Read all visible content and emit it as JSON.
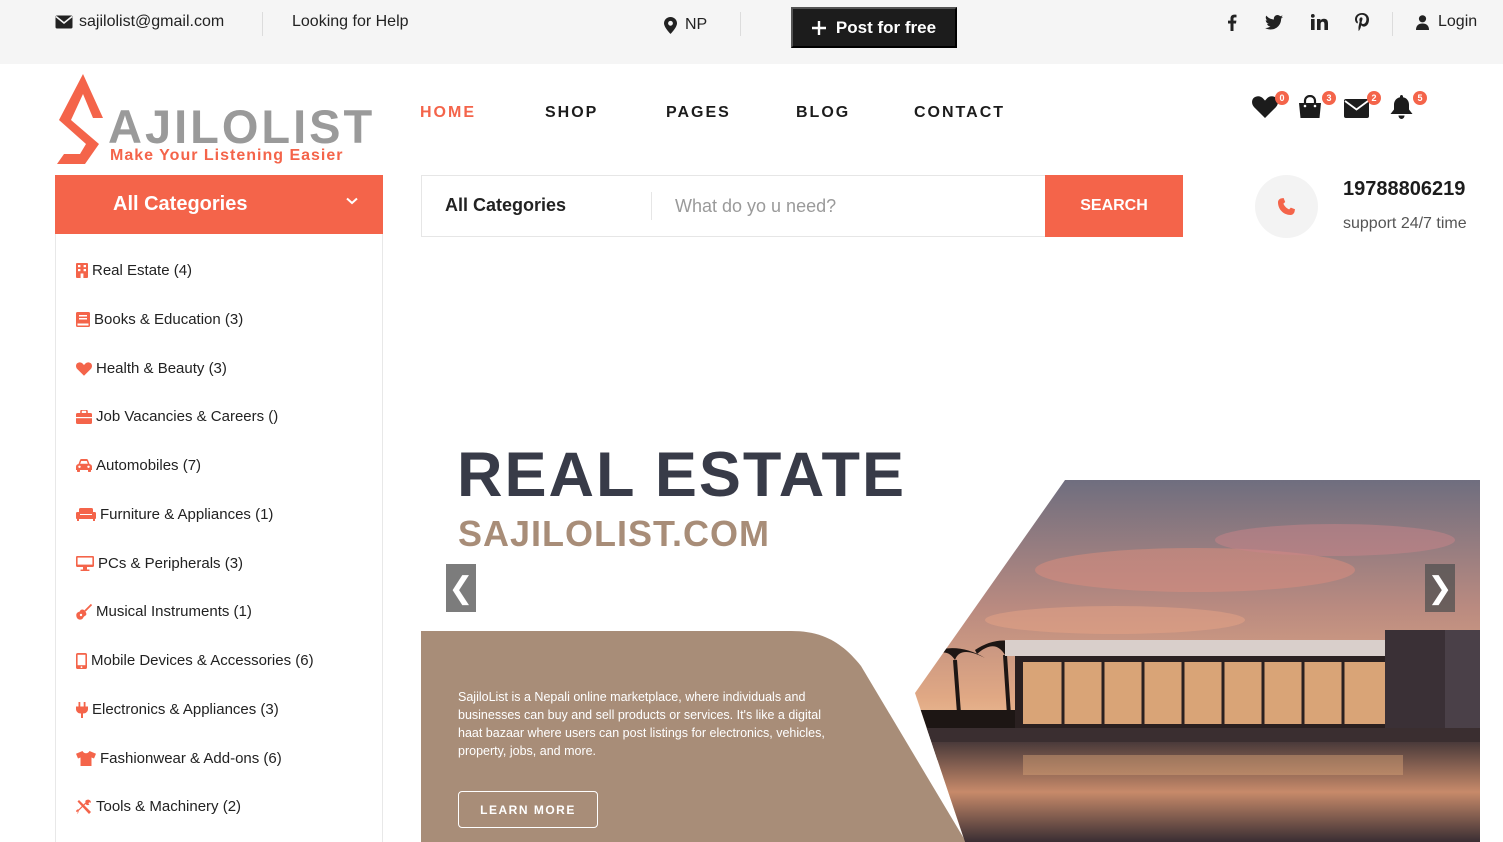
{
  "topbar": {
    "email": "sajilolist@gmail.com",
    "help": "Looking for Help",
    "location": "NP",
    "post_label": "Post for free",
    "social": [
      "facebook-icon",
      "twitter-icon",
      "linkedin-icon",
      "pinterest-icon"
    ],
    "login": "Login"
  },
  "logo": {
    "wordmark": "AJILOLIST",
    "tagline": "Make Your Listening Easier"
  },
  "nav": [
    {
      "label": "HOME",
      "active": true
    },
    {
      "label": "SHOP",
      "active": false
    },
    {
      "label": "PAGES",
      "active": false
    },
    {
      "label": "BLOG",
      "active": false
    },
    {
      "label": "CONTACT",
      "active": false
    }
  ],
  "header_icons": [
    {
      "icon": "heart-icon",
      "count": "0"
    },
    {
      "icon": "shopping-bag-icon",
      "count": "3"
    },
    {
      "icon": "envelope-icon",
      "count": "2"
    },
    {
      "icon": "bell-icon",
      "count": "5"
    }
  ],
  "categories": {
    "title": "All Categories",
    "items": [
      {
        "label": "Real Estate (4)",
        "icon": "building-icon"
      },
      {
        "label": "Books & Education (3)",
        "icon": "book-icon"
      },
      {
        "label": "Health & Beauty (3)",
        "icon": "heart-icon"
      },
      {
        "label": "Job Vacancies & Careers ()",
        "icon": "briefcase-icon"
      },
      {
        "label": "Automobiles (7)",
        "icon": "car-icon"
      },
      {
        "label": "Furniture & Appliances (1)",
        "icon": "couch-icon"
      },
      {
        "label": "PCs & Peripherals (3)",
        "icon": "desktop-icon"
      },
      {
        "label": "Musical Instruments (1)",
        "icon": "guitar-icon"
      },
      {
        "label": "Mobile Devices & Accessories (6)",
        "icon": "mobile-icon"
      },
      {
        "label": "Electronics & Appliances (3)",
        "icon": "plug-icon"
      },
      {
        "label": "Fashionwear & Add-ons (6)",
        "icon": "tshirt-icon"
      },
      {
        "label": "Tools & Machinery (2)",
        "icon": "tools-icon"
      }
    ]
  },
  "search": {
    "category": "All Categories",
    "placeholder": "What do yo u need?",
    "button": "SEARCH"
  },
  "support": {
    "phone": "19788806219",
    "text": "support 24/7 time"
  },
  "hero": {
    "title": "REAL ESTATE",
    "subtitle": "SAJILOLIST.COM",
    "description": "SajiloList is a Nepali online marketplace, where individuals and businesses can buy and sell products or services. It's like a digital haat bazaar where users can post listings for electronics, vehicles, property, jobs, and more.",
    "button": "LEARN MORE",
    "prev": "❮",
    "next": "❯"
  },
  "colors": {
    "accent": "#f4644a",
    "dark": "#1c1c1c",
    "hero_title": "#383b48",
    "hero_tan": "#a88d78"
  }
}
